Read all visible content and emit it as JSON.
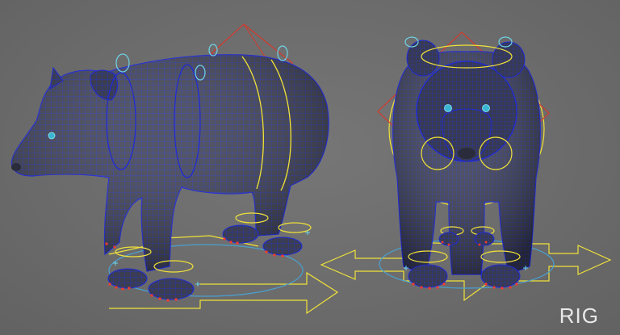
{
  "viewport": {
    "label": "RIG",
    "background": "#6b6b6b",
    "colors": {
      "mesh_fill": "#3d3f4e",
      "wireframe": "#1f2ad6",
      "control_yellow": "#f0e23a",
      "control_cyan": "#6fd3e6",
      "control_red": "#d23a2e",
      "joint_red": "#ff3a2a"
    },
    "views": [
      "side-view",
      "front-view"
    ]
  }
}
